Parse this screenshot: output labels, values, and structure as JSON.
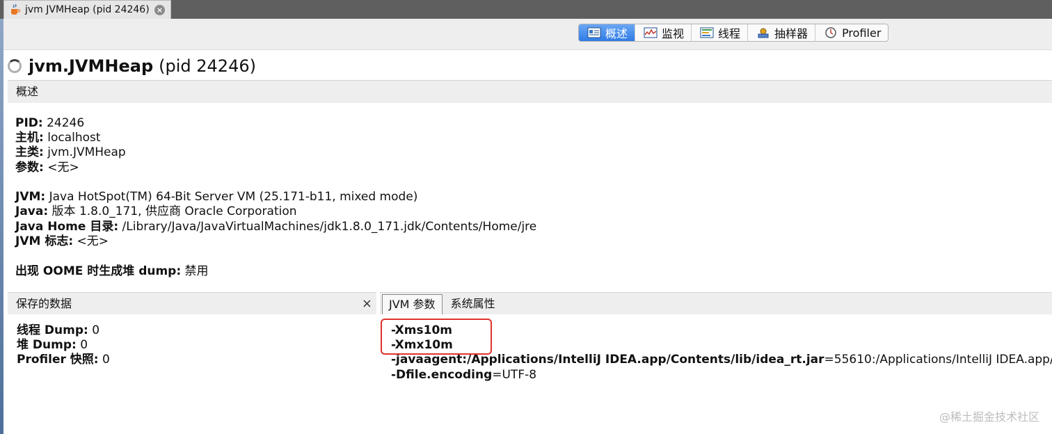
{
  "window_tab": {
    "title": "jvm JVMHeap (pid 24246)",
    "close_glyph": "×"
  },
  "toolbar": {
    "buttons": [
      {
        "label": "概述",
        "icon": "overview-icon",
        "active": true
      },
      {
        "label": "监视",
        "icon": "monitor-icon",
        "active": false
      },
      {
        "label": "线程",
        "icon": "threads-icon",
        "active": false
      },
      {
        "label": "抽样器",
        "icon": "sampler-icon",
        "active": false
      },
      {
        "label": "Profiler",
        "icon": "profiler-icon",
        "active": false
      }
    ]
  },
  "page": {
    "title_bold": "jvm.JVMHeap",
    "title_pid": "(pid 24246)",
    "section": "概述"
  },
  "info": {
    "pid_label": "PID:",
    "pid_value": " 24246",
    "host_label": "主机:",
    "host_value": " localhost",
    "mainclass_label": "主类:",
    "mainclass_value": " jvm.JVMHeap",
    "args_label": "参数:",
    "args_value": " <无>",
    "jvm_label": "JVM:",
    "jvm_value": " Java HotSpot(TM) 64-Bit Server VM (25.171-b11, mixed mode)",
    "java_label": "Java:",
    "java_value": " 版本 1.8.0_171, 供应商 Oracle Corporation",
    "javahome_label": "Java Home 目录:",
    "javahome_value": " /Library/Java/JavaVirtualMachines/jdk1.8.0_171.jdk/Contents/Home/jre",
    "jvmflags_label": "JVM 标志:",
    "jvmflags_value": " <无>",
    "oome_label": "出现 OOME 时生成堆 dump:",
    "oome_value": " 禁用"
  },
  "saved_data": {
    "header": "保存的数据",
    "close_glyph": "×",
    "thread_dump_label": "线程 Dump:",
    "thread_dump_value": " 0",
    "heap_dump_label": "堆 Dump:",
    "heap_dump_value": " 0",
    "profiler_label": "Profiler 快照:",
    "profiler_value": " 0"
  },
  "jvm_args": {
    "tabs": [
      {
        "label": "JVM 参数",
        "selected": true
      },
      {
        "label": "系统属性",
        "selected": false
      }
    ],
    "xms": "-Xms10m",
    "xmx": "-Xmx10m",
    "javaagent_key": "-javaagent:/Applications/IntelliJ IDEA.app/Contents/lib/idea_rt.jar",
    "javaagent_value": "=55610:/Applications/IntelliJ IDEA.app/C",
    "encoding_key": "-Dfile.encoding",
    "encoding_value": "=UTF-8"
  },
  "watermark": "@稀土掘金技术社区",
  "colors": {
    "accent": "#2f7ce6",
    "highlight": "#e0322b",
    "panel": "#eeeeee",
    "tabstrip": "#5f5f5f"
  }
}
